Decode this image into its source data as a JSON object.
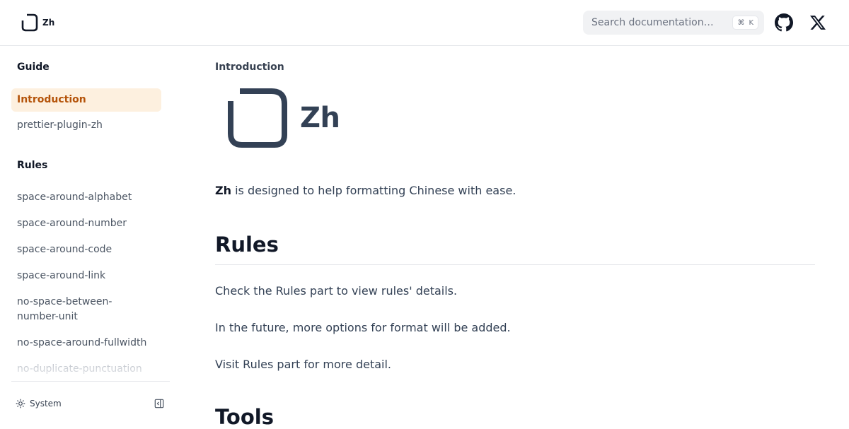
{
  "header": {
    "brand": "Zh",
    "search_placeholder": "Search documentation…",
    "search_shortcut_symbol": "⌘",
    "search_shortcut_key": "K",
    "icons": [
      "github-icon",
      "x-icon"
    ]
  },
  "sidebar": {
    "sections": [
      {
        "heading": "Guide",
        "items": [
          {
            "label": "Introduction",
            "active": true
          },
          {
            "label": "prettier-plugin-zh"
          }
        ]
      },
      {
        "heading": "Rules",
        "items": [
          {
            "label": "space-around-alphabet"
          },
          {
            "label": "space-around-number"
          },
          {
            "label": "space-around-code"
          },
          {
            "label": "space-around-link"
          },
          {
            "label": "no-space-between-number-unit"
          },
          {
            "label": "no-space-around-fullwidth"
          },
          {
            "label": "no-duplicate-punctuation"
          }
        ]
      }
    ],
    "theme_label": "System"
  },
  "main": {
    "breadcrumb": "Introduction",
    "hero_text": "Zh",
    "intro_bold": "Zh",
    "intro_rest": " is designed to help formatting Chinese with ease.",
    "section_rules_title": "Rules",
    "paragraphs": [
      "Check the Rules part to view rules' details.",
      "In the future, more options for format will be added.",
      "Visit Rules part for more detail."
    ],
    "section_tools_title": "Tools"
  },
  "colors": {
    "accent": "#b45309",
    "active_bg": "#fdf0df",
    "logo": "#334155"
  }
}
